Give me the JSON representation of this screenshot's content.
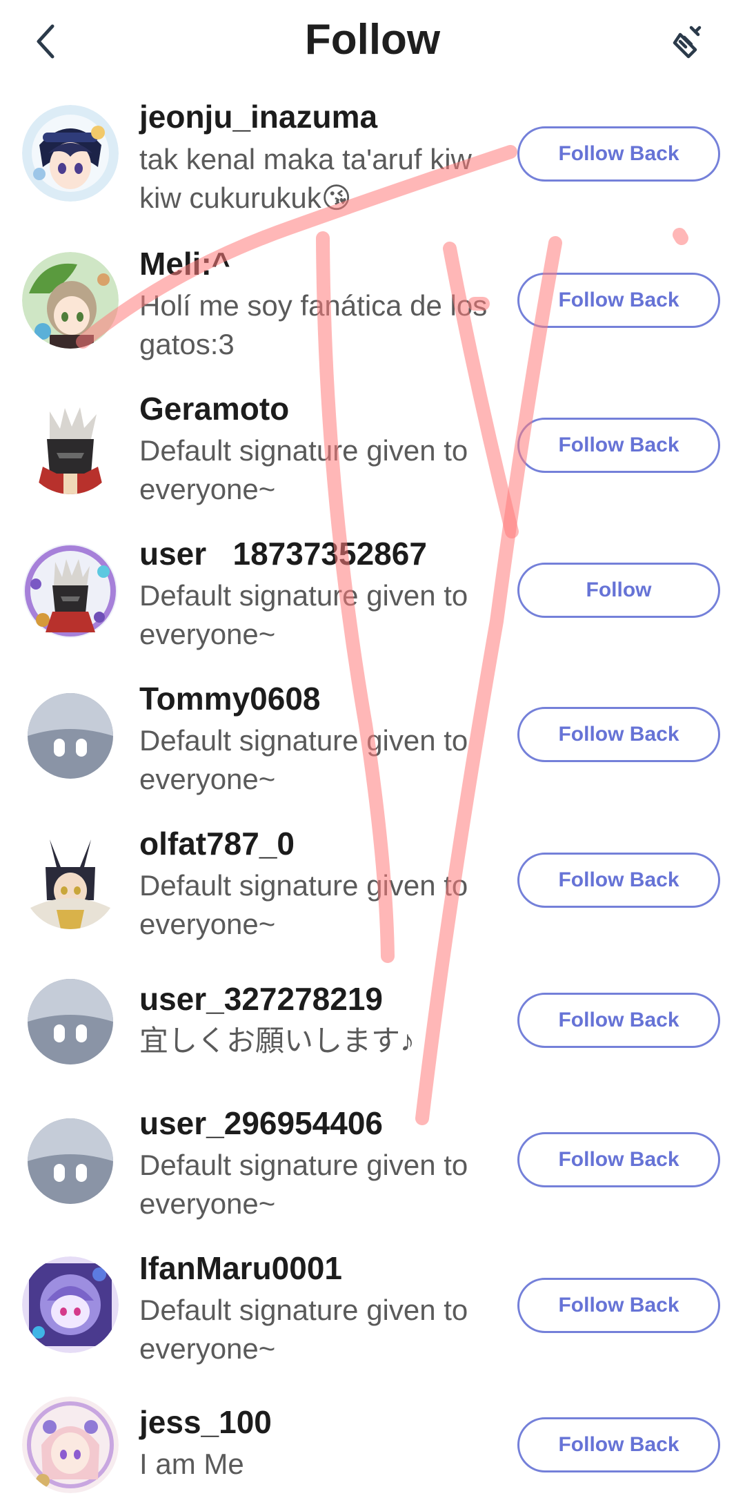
{
  "header": {
    "title": "Follow",
    "back_icon": "chevron-left-icon",
    "clean_icon": "broom-icon"
  },
  "colors": {
    "accent": "#6673d6",
    "text_primary": "#1c1c1c",
    "text_secondary": "#5a5a5a",
    "scribble": "#ff7b7b"
  },
  "users": [
    {
      "username": "jeonju_inazuma",
      "signature": "tak kenal maka ta'aruf kiw kiw cukurukuk😘",
      "button": "Follow Back",
      "avatar": "character-avatar-blue"
    },
    {
      "username": "Meli:^",
      "signature": "Holí me soy fanática de los gatos:3",
      "button": "Follow Back",
      "avatar": "character-avatar-green"
    },
    {
      "username": "Geramoto",
      "signature": "Default signature given to everyone~",
      "button": "Follow Back",
      "avatar": "character-avatar-red"
    },
    {
      "username": "user   18737352867",
      "signature": "Default signature given to everyone~",
      "button": "Follow",
      "avatar": "character-avatar-frame"
    },
    {
      "username": "Tommy0608",
      "signature": "Default signature given to everyone~",
      "button": "Follow Back",
      "avatar": "default-avatar"
    },
    {
      "username": "olfat787_0",
      "signature": "Default signature given to everyone~",
      "button": "Follow Back",
      "avatar": "character-avatar-dark"
    },
    {
      "username": "user_327278219",
      "signature": "宜しくお願いします♪",
      "button": "Follow Back",
      "avatar": "default-avatar"
    },
    {
      "username": "user_296954406",
      "signature": "Default signature given to everyone~",
      "button": "Follow Back",
      "avatar": "default-avatar"
    },
    {
      "username": "IfanMaru0001",
      "signature": "Default signature given to everyone~",
      "button": "Follow Back",
      "avatar": "character-avatar-purple"
    },
    {
      "username": "jess_100",
      "signature": "I am Me",
      "button": "Follow Back",
      "avatar": "character-avatar-pink"
    }
  ]
}
